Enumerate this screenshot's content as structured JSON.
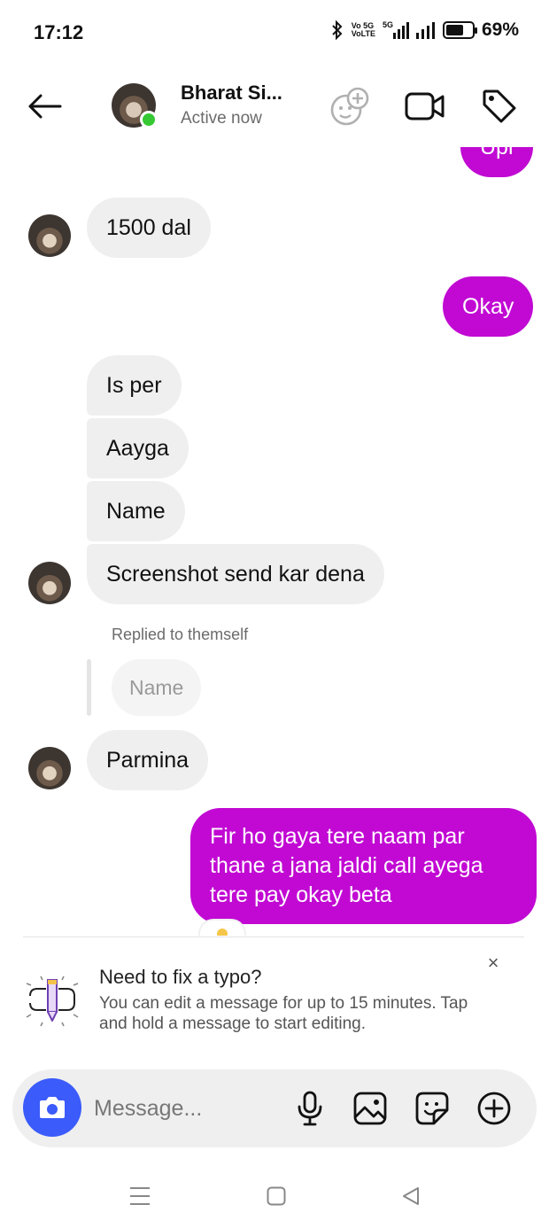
{
  "status_bar": {
    "time": "17:12",
    "network_label_1": "Vo 5G",
    "network_label_2": "VoLTE",
    "signal_label": "5G",
    "battery_percent_text": "69%",
    "battery_level": 0.69
  },
  "header": {
    "contact_name": "Bharat Si...",
    "status": "Active now",
    "online_color": "#36c832"
  },
  "messages": {
    "partial_out": "Upi",
    "m1": "1500 dal",
    "m2": "Okay",
    "m3": "Is per",
    "m4": "Aayga",
    "m5": "Name",
    "m6": "Screenshot send kar dena",
    "reply_note": "Replied to themself",
    "reply_quote": "Name",
    "m7": "Parmina",
    "m8": "Fir ho gaya tere naam par thane a jana jaldi call ayega tere pay okay beta"
  },
  "tip": {
    "title": "Need to fix a typo?",
    "body": "You can edit a message for up to 15 minutes. Tap and hold a message to start editing.",
    "close_label": "×"
  },
  "composer": {
    "placeholder": "Message..."
  },
  "colors": {
    "outgoing_bubble": "#c109d3",
    "incoming_bubble": "#efefef",
    "camera_button": "#3b5bfb"
  }
}
